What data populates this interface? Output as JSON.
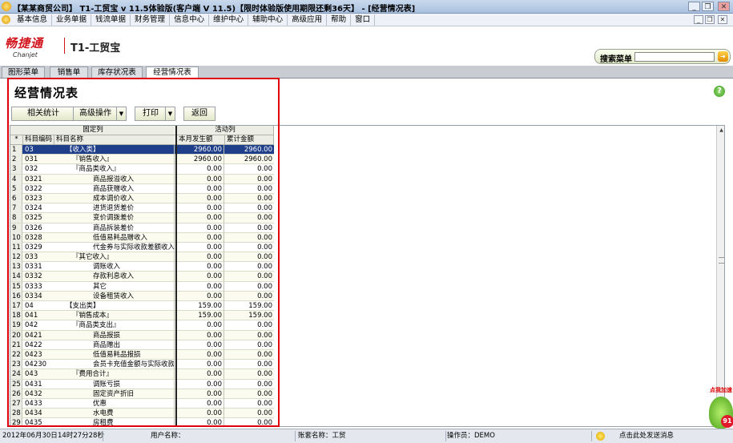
{
  "window": {
    "title": "【某某商贸公司】 T1-工贸宝 v 11.5体验版(客户端 V 11.5)【限时体验版使用期限还剩36天】 - [经营情况表]"
  },
  "menu": [
    "基本信息",
    "业务单据",
    "钱流单据",
    "财务管理",
    "信息中心",
    "维护中心",
    "辅助中心",
    "高级应用",
    "帮助",
    "窗口"
  ],
  "brand": {
    "logo_cn": "畅捷通",
    "logo_en": "Chanjet",
    "product": "T1-工贸宝"
  },
  "search": {
    "label": "搜索菜单",
    "value": "",
    "go_icon": "arrow-icon"
  },
  "tabs": [
    {
      "label": "图形菜单"
    },
    {
      "label": "销售单"
    },
    {
      "label": "库存状况表"
    },
    {
      "label": "经营情况表",
      "active": true
    }
  ],
  "page": {
    "title": "经营情况表"
  },
  "toolbar": {
    "stats": "相关统计",
    "advanced": "高级操作",
    "print": "打印",
    "back": "返回"
  },
  "grid": {
    "group_fixed": "固定列",
    "group_active": "活动列",
    "col_no": "",
    "col_code": "科目编码",
    "col_name": "科目名称",
    "col_month": "本月发生额",
    "col_total": "累计金额",
    "rows": [
      {
        "n": "1",
        "code": "03",
        "name": "【收入类】",
        "m": "2960.00",
        "t": "2960.00",
        "indent": 0,
        "sel": true
      },
      {
        "n": "2",
        "code": "031",
        "name": "『销售收入』",
        "m": "2960.00",
        "t": "2960.00",
        "indent": 1
      },
      {
        "n": "3",
        "code": "032",
        "name": "『商品类收入』",
        "m": "0.00",
        "t": "0.00",
        "indent": 1
      },
      {
        "n": "4",
        "code": "0321",
        "name": "商品报溢收入",
        "m": "0.00",
        "t": "0.00",
        "indent": 2
      },
      {
        "n": "5",
        "code": "0322",
        "name": "商品获赠收入",
        "m": "0.00",
        "t": "0.00",
        "indent": 2
      },
      {
        "n": "6",
        "code": "0323",
        "name": "成本调价收入",
        "m": "0.00",
        "t": "0.00",
        "indent": 2
      },
      {
        "n": "7",
        "code": "0324",
        "name": "进货退货差价",
        "m": "0.00",
        "t": "0.00",
        "indent": 2
      },
      {
        "n": "8",
        "code": "0325",
        "name": "变价调拨差价",
        "m": "0.00",
        "t": "0.00",
        "indent": 2
      },
      {
        "n": "9",
        "code": "0326",
        "name": "商品拆装差价",
        "m": "0.00",
        "t": "0.00",
        "indent": 2
      },
      {
        "n": "10",
        "code": "0328",
        "name": "低值易耗品赠收入",
        "m": "0.00",
        "t": "0.00",
        "indent": 2
      },
      {
        "n": "11",
        "code": "0329",
        "name": "代金券与实际收款差额收入",
        "m": "0.00",
        "t": "0.00",
        "indent": 2
      },
      {
        "n": "12",
        "code": "033",
        "name": "『其它收入』",
        "m": "0.00",
        "t": "0.00",
        "indent": 1
      },
      {
        "n": "13",
        "code": "0331",
        "name": "调账收入",
        "m": "0.00",
        "t": "0.00",
        "indent": 2
      },
      {
        "n": "14",
        "code": "0332",
        "name": "存款利息收入",
        "m": "0.00",
        "t": "0.00",
        "indent": 2
      },
      {
        "n": "15",
        "code": "0333",
        "name": "其它",
        "m": "0.00",
        "t": "0.00",
        "indent": 2
      },
      {
        "n": "16",
        "code": "0334",
        "name": "设备租赁收入",
        "m": "0.00",
        "t": "0.00",
        "indent": 2
      },
      {
        "n": "17",
        "code": "04",
        "name": "【支出类】",
        "m": "159.00",
        "t": "159.00",
        "indent": 0
      },
      {
        "n": "18",
        "code": "041",
        "name": "『销售成本』",
        "m": "159.00",
        "t": "159.00",
        "indent": 1
      },
      {
        "n": "19",
        "code": "042",
        "name": "『商品类支出』",
        "m": "0.00",
        "t": "0.00",
        "indent": 1
      },
      {
        "n": "20",
        "code": "0421",
        "name": "商品报损",
        "m": "0.00",
        "t": "0.00",
        "indent": 2
      },
      {
        "n": "21",
        "code": "0422",
        "name": "商品赠出",
        "m": "0.00",
        "t": "0.00",
        "indent": 2
      },
      {
        "n": "22",
        "code": "0423",
        "name": "低值易耗品报损",
        "m": "0.00",
        "t": "0.00",
        "indent": 2
      },
      {
        "n": "23",
        "code": "04230",
        "name": "会员卡充值金额与实际收款差",
        "m": "0.00",
        "t": "0.00",
        "indent": 2
      },
      {
        "n": "24",
        "code": "043",
        "name": "『费用合计』",
        "m": "0.00",
        "t": "0.00",
        "indent": 1
      },
      {
        "n": "25",
        "code": "0431",
        "name": "调账亏损",
        "m": "0.00",
        "t": "0.00",
        "indent": 2
      },
      {
        "n": "26",
        "code": "0432",
        "name": "固定资产折旧",
        "m": "0.00",
        "t": "0.00",
        "indent": 2
      },
      {
        "n": "27",
        "code": "0433",
        "name": "优惠",
        "m": "0.00",
        "t": "0.00",
        "indent": 2
      },
      {
        "n": "28",
        "code": "0434",
        "name": "水电费",
        "m": "0.00",
        "t": "0.00",
        "indent": 2
      },
      {
        "n": "29",
        "code": "0435",
        "name": "房租费",
        "m": "0.00",
        "t": "0.00",
        "indent": 2
      }
    ]
  },
  "status": {
    "date": "2012年06月30日",
    "time": "14时27分28秒",
    "user_label": "用户名称：",
    "account": "账套名称：工贸",
    "operator": "操作员：DEMO",
    "message": "点击此处发送消息"
  },
  "float": {
    "label": "点我加速",
    "count": "91"
  }
}
